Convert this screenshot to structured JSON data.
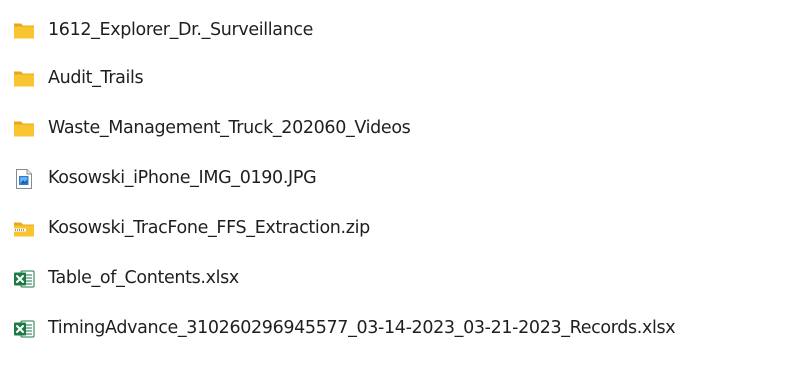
{
  "files": [
    {
      "name": "1612_Explorer_Dr._Surveillance",
      "icon": "folder-icon"
    },
    {
      "name": "Audit_Trails",
      "icon": "folder-icon"
    },
    {
      "name": "Waste_Management_Truck_202060_Videos",
      "icon": "folder-icon"
    },
    {
      "name": "Kosowski_iPhone_IMG_0190.JPG",
      "icon": "image-file-icon"
    },
    {
      "name": "Kosowski_TracFone_FFS_Extraction.zip",
      "icon": "zip-folder-icon"
    },
    {
      "name": "Table_of_Contents.xlsx",
      "icon": "excel-file-icon"
    },
    {
      "name": "TimingAdvance_310260296945577_03-14-2023_03-21-2023_Records.xlsx",
      "icon": "excel-file-icon"
    }
  ],
  "colors": {
    "folder": "#F8C430",
    "folder_tab": "#E8A919",
    "excel_green": "#1D7A45",
    "image_blue": "#2B7CD3"
  }
}
